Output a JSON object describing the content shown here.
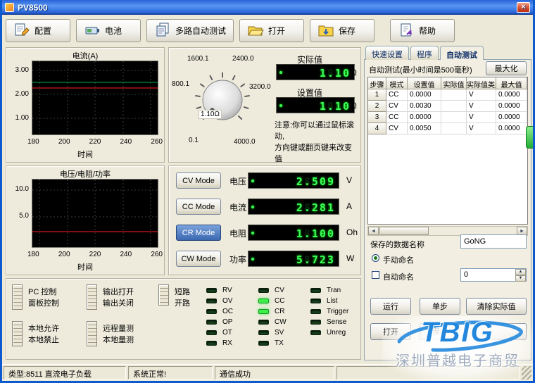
{
  "colors": {
    "led_on": "#3cf04a",
    "led_off": "#16401c",
    "seg_green": "#3cff5a",
    "accent_blue": "#3a68b0"
  },
  "glyphs": {
    "close": "×",
    "scroll_left": "◄",
    "scroll_right": "►",
    "spin_up": "▲",
    "spin_down": "▼"
  },
  "window": {
    "title": "PV8500"
  },
  "toolbar": {
    "buttons": [
      {
        "label": "配置"
      },
      {
        "label": "电池"
      },
      {
        "label": "多路自动测试"
      },
      {
        "label": "打开"
      },
      {
        "label": "保存"
      },
      {
        "label": "帮助"
      }
    ]
  },
  "chart_current": {
    "title": "电流(A)",
    "y_ticks": [
      "3.00",
      "2.00",
      "1.00"
    ],
    "x_ticks": [
      "180",
      "200",
      "220",
      "240",
      "260"
    ],
    "xlabel": "时间"
  },
  "chart_vrp": {
    "title": "电压/电阻/功率",
    "y_ticks": [
      "10.0",
      "5.0"
    ],
    "x_ticks": [
      "180",
      "200",
      "220",
      "240",
      "260"
    ],
    "xlabel": "时间"
  },
  "knob_panel": {
    "actual_label": "实际值",
    "actual_value": "1.10",
    "actual_unit": "Ω",
    "set_label": "设置值",
    "set_value": "1.10",
    "set_unit": "Ω",
    "ghost": "8888",
    "knob_value": "1.10Ω",
    "scale_min": "0.1",
    "scale_800": "800.1",
    "scale_1600": "1600.1",
    "scale_2400": "2400.0",
    "scale_3200": "3200.0",
    "scale_max": "4000.0",
    "note_line1": "注意:你可以通过鼠标滚动,",
    "note_line2": "方向键或翻页键来改变值"
  },
  "mode_panel": {
    "ghost": "8888",
    "rows": [
      {
        "button": "CV Mode",
        "label": "电压",
        "value": "2.509",
        "unit": "V"
      },
      {
        "button": "CC Mode",
        "label": "电流",
        "value": "2.281",
        "unit": "A"
      },
      {
        "button": "CR Mode",
        "label": "电阻",
        "value": "1.100",
        "unit": "Oh"
      },
      {
        "button": "CW Mode",
        "label": "功率",
        "value": "5.723",
        "unit": "W"
      }
    ]
  },
  "status_panel": {
    "toggles": [
      {
        "top": "PC 控制",
        "bottom": "面板控制"
      },
      {
        "top": "本地允许",
        "bottom": "本地禁止"
      },
      {
        "top": "输出打开",
        "bottom": "输出关闭"
      },
      {
        "top": "远程量测",
        "bottom": "本地量测"
      },
      {
        "top": "短路",
        "bottom": "开路"
      }
    ],
    "leds_col1": [
      "RV",
      "OV",
      "OC",
      "OP",
      "OT",
      "RX"
    ],
    "leds_col2": [
      "CV",
      "CC",
      "CR",
      "CW",
      "SV",
      "TX"
    ],
    "leds_col3": [
      "Tran",
      "List",
      "Trigger",
      "Sense",
      "Unreg"
    ],
    "lit": [
      "CC",
      "CR"
    ]
  },
  "right_panel": {
    "tabs": [
      "快速设置",
      "程序",
      "自动测试"
    ],
    "active_tab": "自动测试",
    "header": "自动测试(最小时间是500毫秒)",
    "maximize_button": "最大化",
    "table": {
      "headers": [
        "步骤",
        "模式",
        "设置值",
        "实际值",
        "实际值类型",
        "最大值"
      ],
      "rows": [
        {
          "step": "1",
          "mode": "CC",
          "set": "0.0000",
          "actual": "",
          "type": "V",
          "max": "0.0000"
        },
        {
          "step": "2",
          "mode": "CV",
          "set": "0.0030",
          "actual": "",
          "type": "V",
          "max": "0.0000"
        },
        {
          "step": "3",
          "mode": "CC",
          "set": "0.0000",
          "actual": "",
          "type": "V",
          "max": "0.0000"
        },
        {
          "step": "4",
          "mode": "CV",
          "set": "0.0050",
          "actual": "",
          "type": "V",
          "max": "0.0000"
        }
      ]
    },
    "save_name_label": "保存的数据名称",
    "save_name_value": "GoNG",
    "manual_name_label": "手动命名",
    "auto_name_label": "自动命名",
    "auto_name_count": "0",
    "run_button": "运行",
    "step_button": "单步",
    "clear_button": "清除实际值",
    "open_button": "打开",
    "save_button": "保存"
  },
  "status_bar": {
    "model": "类型:8511 直流电子负载",
    "system": "系统正常!",
    "comm": "通信成功"
  },
  "watermark": {
    "logo": "TBIG",
    "text": "深圳普越电子商贸"
  }
}
